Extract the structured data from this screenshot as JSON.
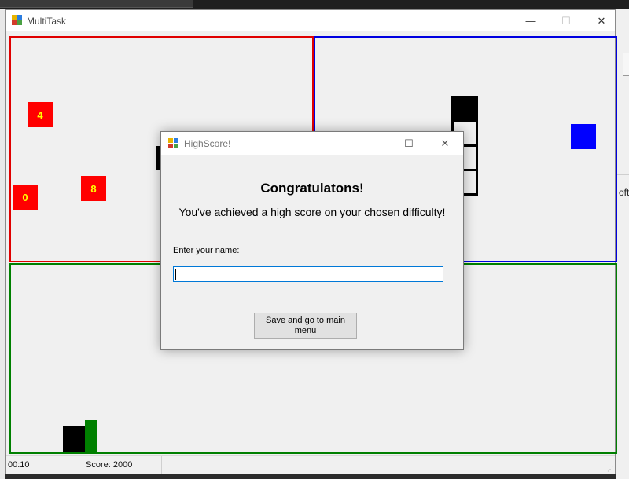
{
  "window": {
    "title": "MultiTask",
    "controls": {
      "minimize": "—",
      "maximize": "☐",
      "close": "✕"
    }
  },
  "game": {
    "number_boxes": [
      "4",
      "0",
      "8"
    ],
    "colors": {
      "red_panel": "#e00000",
      "blue_panel": "#0000e0",
      "green_panel": "#008000",
      "number_box": "#ff0000",
      "number_text": "#ffff00"
    }
  },
  "statusbar": {
    "time": "00:10",
    "score": "Score: 2000"
  },
  "dialog": {
    "title": "HighScore!",
    "controls": {
      "minimize": "—",
      "maximize": "☐",
      "close": "✕"
    },
    "heading": "Congratulatons!",
    "message": "You've achieved a high score on your chosen difficulty!",
    "name_label": "Enter your name:",
    "name_value": "",
    "save_button": "Save and go to main menu"
  },
  "background": {
    "right_text": "oft"
  }
}
